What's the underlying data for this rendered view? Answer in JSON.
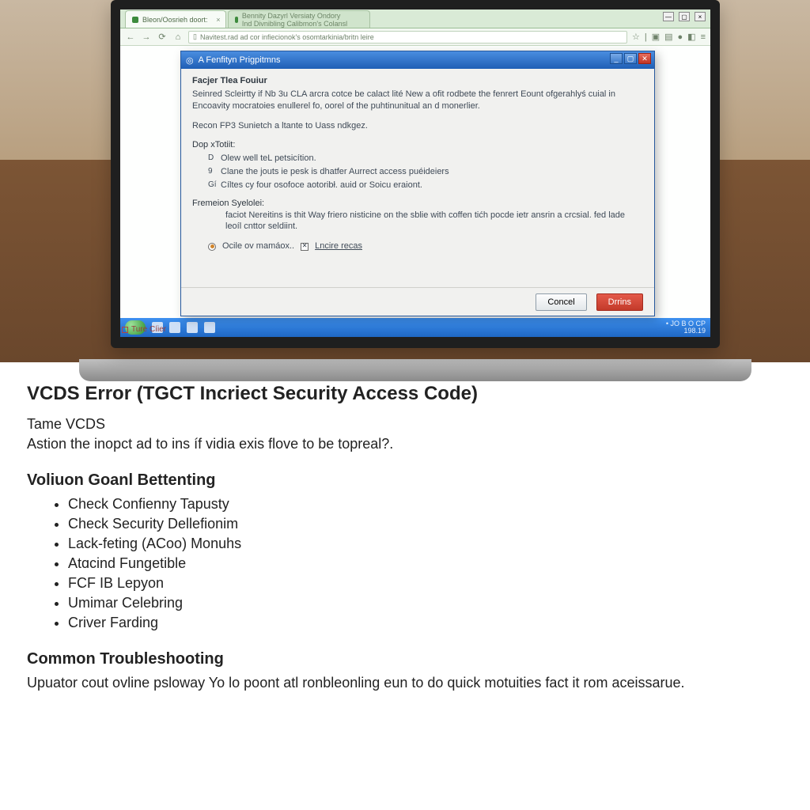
{
  "browser": {
    "tab1": "Bleon/Oosrieh doort:",
    "tab2": "Bennity Dazyrl Versiaty Ondory Ind Divnibling Calibmon's Colansl",
    "urlbar": "Navitest.rad ad cor infiecionok's osomtarkinia/britn leire",
    "win_min": "—",
    "win_max": "▢",
    "win_close": "×"
  },
  "dialog": {
    "title": "A Fenfityn Prigpitmns",
    "heading": "Facjer Tlea Fouiur",
    "para1": "Seinred Scleirtty if Nb 3u CLA arcra cotce be calact lité New a ofit rodbete the fenrert Eount ofgerahlyś cuial in Encoavity mocratoies enullerel fo, oorel of the puhtinunitual an d monerlier.",
    "line2": "Recon FP3 Sunietch a ltante to Uass ndkgez.",
    "sub1": "Dop xTotiit:",
    "b1_mark": "D",
    "b1": "Olew well teL petsicítion.",
    "b2_mark": "9",
    "b2": "Clane the jouts ie pesk is dhatfer Aurrect access puéideiers",
    "b3_mark": "Gí",
    "b3": "Cíltes cy four osofoce aotoribł. auid or Soicu eraiont.",
    "sub2": "Fremeion Syelolei:",
    "para2": "faciot Nereitins is thit Way friero nisticine on the sblie with coffen tićh pocde ietr ansrin a crcsial. fed lade leoíl cnttor seldiint.",
    "radio_label": "Ocile ov mamáox..",
    "check_label": "Lncire recas",
    "cancel": "Concel",
    "ok": "Drrins"
  },
  "aux_badge": "Ture Cíier",
  "clock": {
    "l1": "• JO B  O  CP",
    "l2": "198.19"
  },
  "article": {
    "title": "VCDS Error (TGCT Incriect Security Access Code)",
    "line1": "Tame VCDS",
    "line2": "Astion the inopct ad to ins íf vidia exis flove to be topreal?.",
    "section1": "Voliuon Goanl Bettenting",
    "bullets": [
      "Check Confienny Tapusty",
      "Check Security Dellefionim",
      "Lack-feting (ACoo) Monuhs",
      "Atɑcind Fungetible",
      "FCF IB Lepyon",
      "Umimar Celebring",
      "Criver Farding"
    ],
    "section2": "Common Troubleshooting",
    "foot": "Upuator cout ovline psloway Yo lo poont atl ronbleonling eun to do quick motuities fact it rom aceissarue."
  }
}
